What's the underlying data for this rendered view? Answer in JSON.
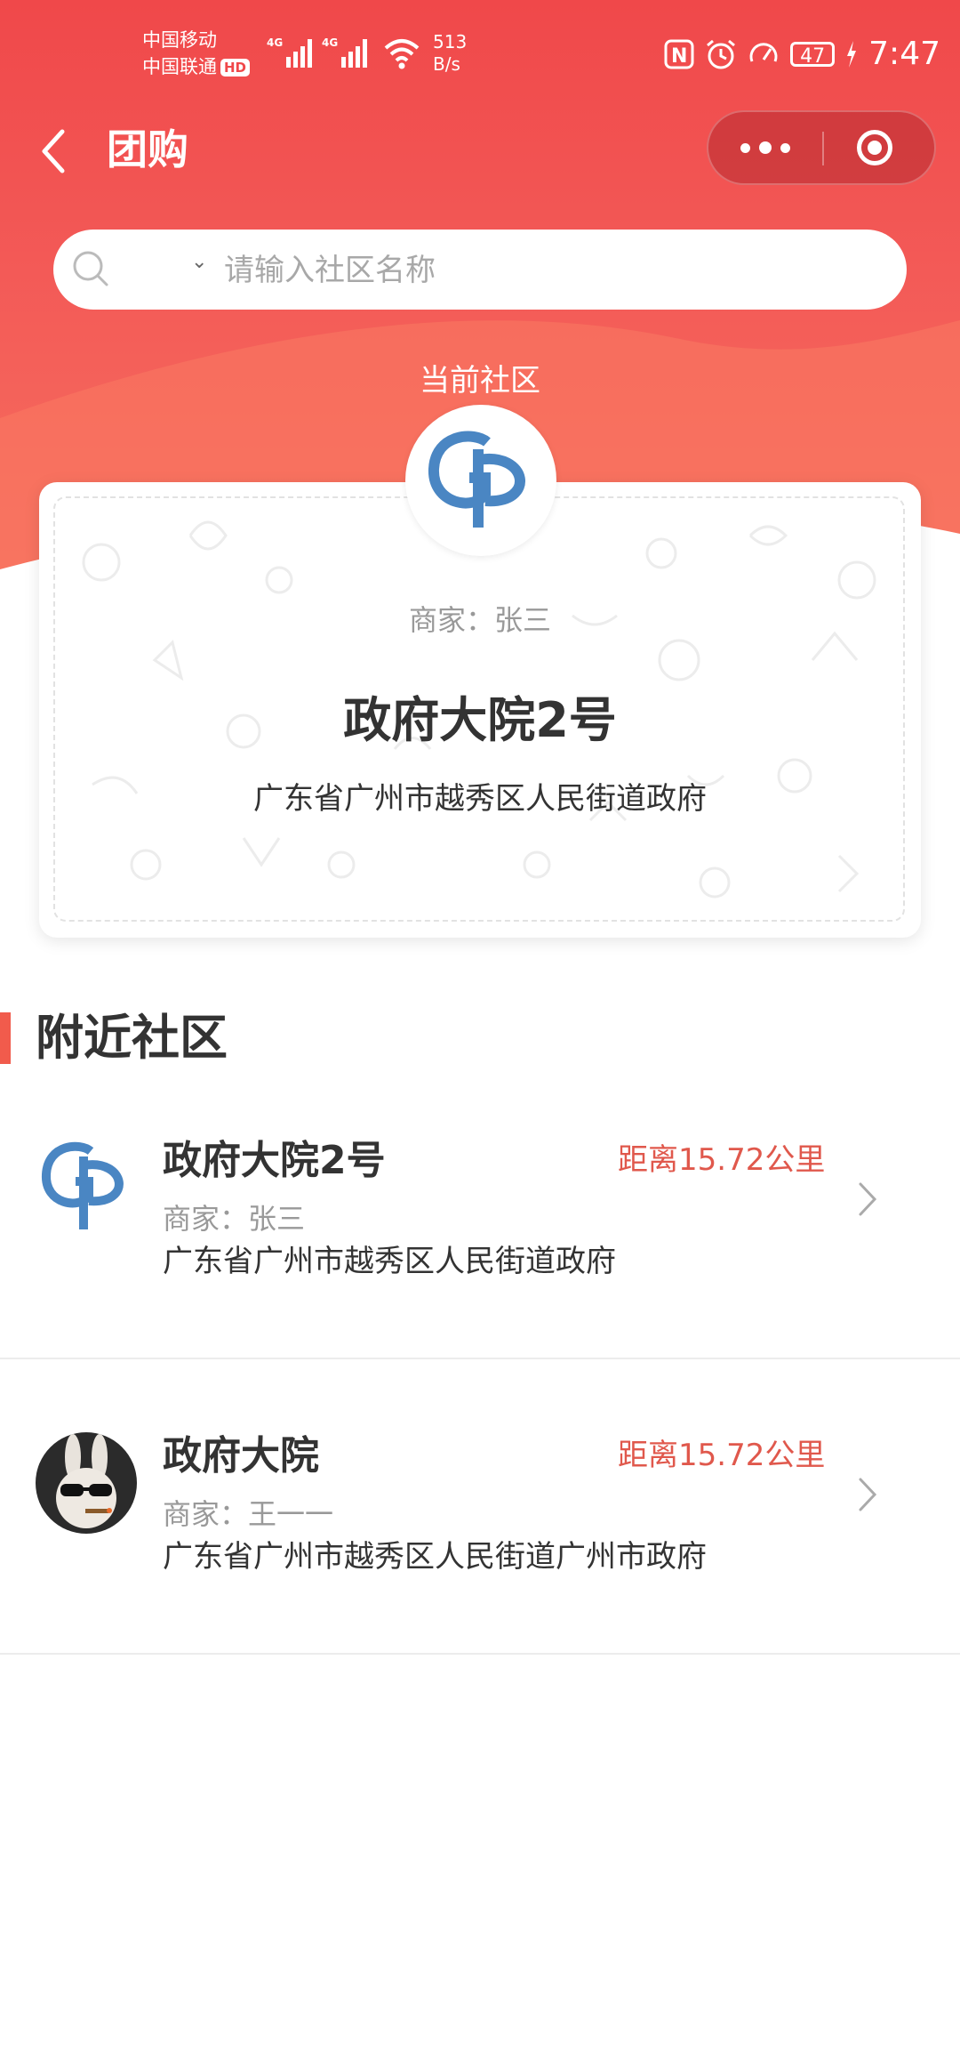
{
  "status_bar": {
    "carrier1": "中国移动",
    "carrier2": "中国联通",
    "hd": "HD",
    "net_speed": "513",
    "net_unit": "B/s",
    "battery": "47",
    "time": "7:47"
  },
  "nav": {
    "title": "团购"
  },
  "search": {
    "placeholder": "请输入社区名称"
  },
  "current": {
    "label": "当前社区",
    "merchant": "商家：张三",
    "name": "政府大院2号",
    "address": "广东省广州市越秀区人民街道政府"
  },
  "nearby": {
    "title": "附近社区",
    "items": [
      {
        "name": "政府大院2号",
        "distance": "距离15.72公里",
        "merchant": "商家：张三",
        "address": "广东省广州市越秀区人民街道政府"
      },
      {
        "name": "政府大院",
        "distance": "距离15.72公里",
        "merchant": "商家：王一一",
        "address": "广东省广州市越秀区人民街道广州市政府"
      }
    ]
  },
  "colors": {
    "brand": "#f0484a",
    "distance": "#e0584c"
  }
}
